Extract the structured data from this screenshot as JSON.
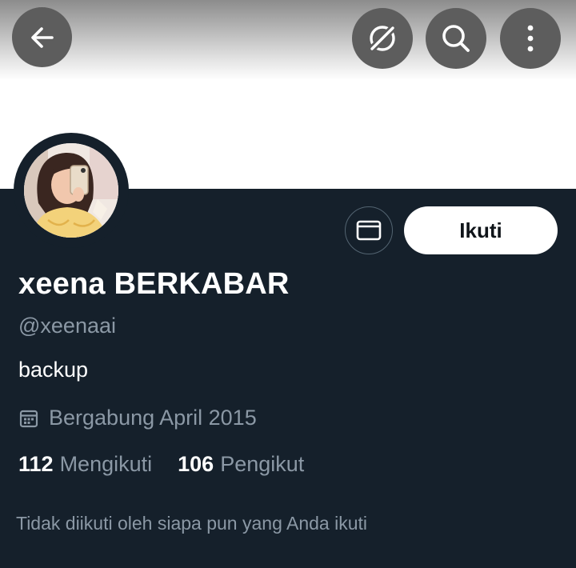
{
  "header": {
    "back_icon": "arrow-left-icon",
    "grok_icon": "grok-icon",
    "search_icon": "search-icon",
    "more_icon": "more-vertical-icon"
  },
  "profile": {
    "display_name": "xeena BERKABAR",
    "handle": "@xeenaai",
    "bio": "backup",
    "joined": "Bergabung April 2015",
    "following_count": "112",
    "following_label": "Mengikuti",
    "followers_count": "106",
    "followers_label": "Pengikut",
    "followed_by_note": "Tidak diikuti oleh siapa pun yang Anda ikuti"
  },
  "actions": {
    "message_icon": "envelope-icon",
    "follow_label": "Ikuti"
  },
  "colors": {
    "background": "#15202b",
    "secondary_text": "#8b98a5",
    "primary_text": "#ffffff",
    "follow_button_bg": "#ffffff"
  }
}
